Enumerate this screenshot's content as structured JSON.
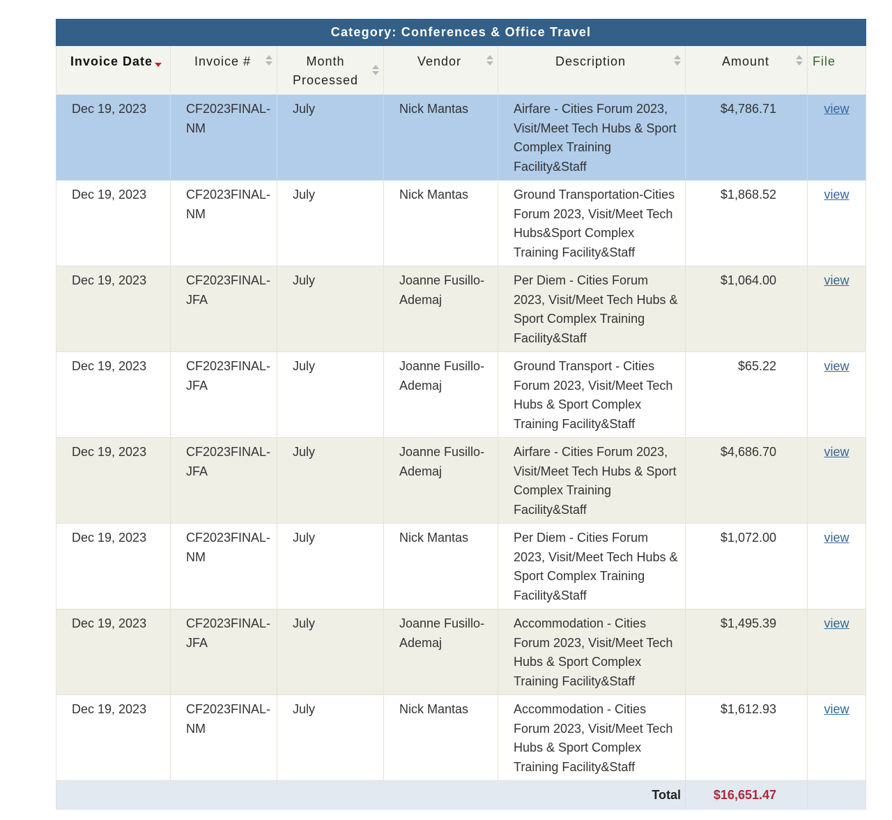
{
  "table": {
    "category_title": "Category: Conferences & Office Travel",
    "columns": {
      "invoice_date": "Invoice Date",
      "invoice_no": "Invoice #",
      "month_processed": "Month Processed",
      "vendor": "Vendor",
      "description": "Description",
      "amount": "Amount",
      "file": "File"
    },
    "rows": [
      {
        "date": "Dec 19, 2023",
        "invoice": "CF2023FINAL-NM",
        "month": "July",
        "vendor": "Nick Mantas",
        "description": "Airfare - Cities Forum 2023, Visit/Meet Tech Hubs & Sport Complex Training Facility&Staff",
        "amount": "$4,786.71",
        "file": "view"
      },
      {
        "date": "Dec 19, 2023",
        "invoice": "CF2023FINAL-NM",
        "month": "July",
        "vendor": "Nick Mantas",
        "description": "Ground Transportation-Cities Forum 2023, Visit/Meet Tech Hubs&Sport Complex Training Facility&Staff",
        "amount": "$1,868.52",
        "file": "view"
      },
      {
        "date": "Dec 19, 2023",
        "invoice": "CF2023FINAL-JFA",
        "month": "July",
        "vendor": "Joanne Fusillo-Ademaj",
        "description": "Per Diem - Cities Forum 2023, Visit/Meet Tech Hubs & Sport Complex Training Facility&Staff",
        "amount": "$1,064.00",
        "file": "view"
      },
      {
        "date": "Dec 19, 2023",
        "invoice": "CF2023FINAL-JFA",
        "month": "July",
        "vendor": "Joanne Fusillo-Ademaj",
        "description": "Ground Transport - Cities Forum 2023, Visit/Meet Tech Hubs & Sport Complex Training Facility&Staff",
        "amount": "$65.22",
        "file": "view"
      },
      {
        "date": "Dec 19, 2023",
        "invoice": "CF2023FINAL-JFA",
        "month": "July",
        "vendor": "Joanne Fusillo-Ademaj",
        "description": "Airfare - Cities Forum 2023, Visit/Meet Tech Hubs & Sport Complex Training Facility&Staff",
        "amount": "$4,686.70",
        "file": "view"
      },
      {
        "date": "Dec 19, 2023",
        "invoice": "CF2023FINAL-NM",
        "month": "July",
        "vendor": "Nick Mantas",
        "description": "Per Diem - Cities Forum 2023, Visit/Meet Tech Hubs & Sport Complex Training Facility&Staff",
        "amount": "$1,072.00",
        "file": "view"
      },
      {
        "date": "Dec 19, 2023",
        "invoice": "CF2023FINAL-JFA",
        "month": "July",
        "vendor": "Joanne Fusillo-Ademaj",
        "description": "Accommodation - Cities Forum 2023, Visit/Meet Tech Hubs & Sport Complex Training Facility&Staff",
        "amount": "$1,495.39",
        "file": "view"
      },
      {
        "date": "Dec 19, 2023",
        "invoice": "CF2023FINAL-NM",
        "month": "July",
        "vendor": "Nick Mantas",
        "description": "Accommodation - Cities Forum 2023, Visit/Meet Tech Hubs & Sport Complex Training Facility&Staff",
        "amount": "$1,612.93",
        "file": "view"
      }
    ],
    "footer": {
      "total_label": "Total",
      "total_amount": "$16,651.47"
    },
    "colors": {
      "header_bg": "#336088",
      "selected_row": "#b1cde9",
      "alt_row": "#efefe6",
      "total_amount": "#b0283a",
      "link": "#336699"
    },
    "sort": {
      "column": "invoice_date",
      "direction": "desc"
    },
    "selected_row_index": 0
  }
}
